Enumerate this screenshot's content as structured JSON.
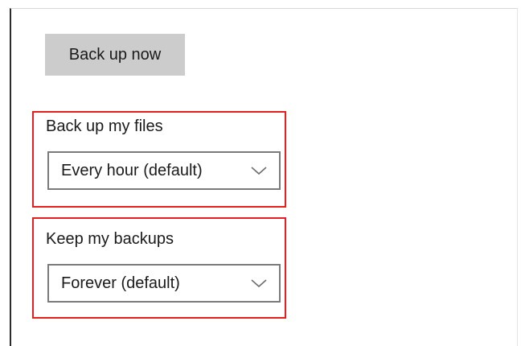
{
  "backup": {
    "button_label": "Back up now"
  },
  "files_group": {
    "label": "Back up my files",
    "selected": "Every hour (default)"
  },
  "keep_group": {
    "label": "Keep my backups",
    "selected": "Forever (default)"
  },
  "icons": {
    "dropdown": "chevron-down-icon"
  },
  "colors": {
    "highlight_border": "#e81e1e",
    "button_bg": "#cccccc",
    "dropdown_border": "#7a7a7a"
  }
}
